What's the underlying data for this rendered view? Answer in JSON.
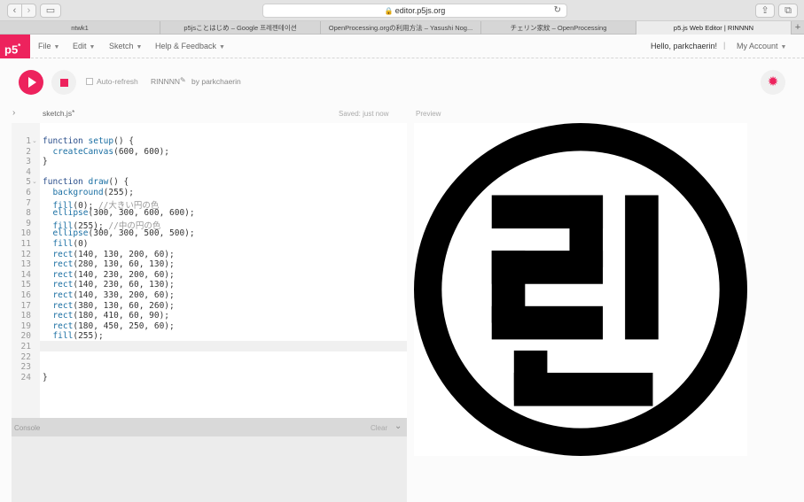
{
  "browser": {
    "url": "editor.p5js.org",
    "tabs": [
      {
        "label": "ntwk1",
        "active": false
      },
      {
        "label": "p5jsことはじめ – Google 프레젠테이션",
        "active": false
      },
      {
        "label": "OpenProcessing.orgの利用方法 – Yasushi Nog...",
        "active": false
      },
      {
        "label": "チェリン家紋 – OpenProcessing",
        "active": false
      },
      {
        "label": "p5.js Web Editor | RINNNN",
        "active": true
      }
    ],
    "new_tab": "+"
  },
  "nav": {
    "logo": "p5",
    "logo_sup": "*",
    "menus": [
      "File",
      "Edit",
      "Sketch",
      "Help & Feedback"
    ],
    "greeting": "Hello, parkchaerin!",
    "divider": "|",
    "account": "My Account"
  },
  "toolbar": {
    "autorefresh_label": "Auto-refresh",
    "sketch_name": "RINNNN",
    "author": "by parkchaerin"
  },
  "editor": {
    "file_name": "sketch.js",
    "unsaved_marker": "*",
    "save_status": "Saved: just now",
    "preview_label": "Preview",
    "active_line": 21,
    "lines": [
      {
        "n": "1",
        "fold": true,
        "t": "function setup() {"
      },
      {
        "n": "2",
        "fold": false,
        "t": "  createCanvas(600, 600);"
      },
      {
        "n": "3",
        "fold": false,
        "t": "}"
      },
      {
        "n": "4",
        "fold": false,
        "t": ""
      },
      {
        "n": "5",
        "fold": true,
        "t": "function draw() {"
      },
      {
        "n": "6",
        "fold": false,
        "t": "  background(255);"
      },
      {
        "n": "7",
        "fold": false,
        "t": "  fill(0); //大きい円の色"
      },
      {
        "n": "8",
        "fold": false,
        "t": "  ellipse(300, 300, 600, 600);"
      },
      {
        "n": "9",
        "fold": false,
        "t": "  fill(255); //中の円の色"
      },
      {
        "n": "10",
        "fold": false,
        "t": "  ellipse(300, 300, 500, 500);"
      },
      {
        "n": "11",
        "fold": false,
        "t": "  fill(0)"
      },
      {
        "n": "12",
        "fold": false,
        "t": "  rect(140, 130, 200, 60);"
      },
      {
        "n": "13",
        "fold": false,
        "t": "  rect(280, 130, 60, 130);"
      },
      {
        "n": "14",
        "fold": false,
        "t": "  rect(140, 230, 200, 60);"
      },
      {
        "n": "15",
        "fold": false,
        "t": "  rect(140, 230, 60, 130);"
      },
      {
        "n": "16",
        "fold": false,
        "t": "  rect(140, 330, 200, 60);"
      },
      {
        "n": "17",
        "fold": false,
        "t": "  rect(380, 130, 60, 260);"
      },
      {
        "n": "18",
        "fold": false,
        "t": "  rect(180, 410, 60, 90);"
      },
      {
        "n": "19",
        "fold": false,
        "t": "  rect(180, 450, 250, 60);"
      },
      {
        "n": "20",
        "fold": false,
        "t": "  fill(255);"
      },
      {
        "n": "21",
        "fold": false,
        "t": ""
      },
      {
        "n": "22",
        "fold": false,
        "t": ""
      },
      {
        "n": "23",
        "fold": false,
        "t": ""
      },
      {
        "n": "24",
        "fold": false,
        "t": "}"
      }
    ]
  },
  "console": {
    "label": "Console",
    "clear_label": "Clear"
  },
  "colors": {
    "accent": "#ed225d"
  }
}
